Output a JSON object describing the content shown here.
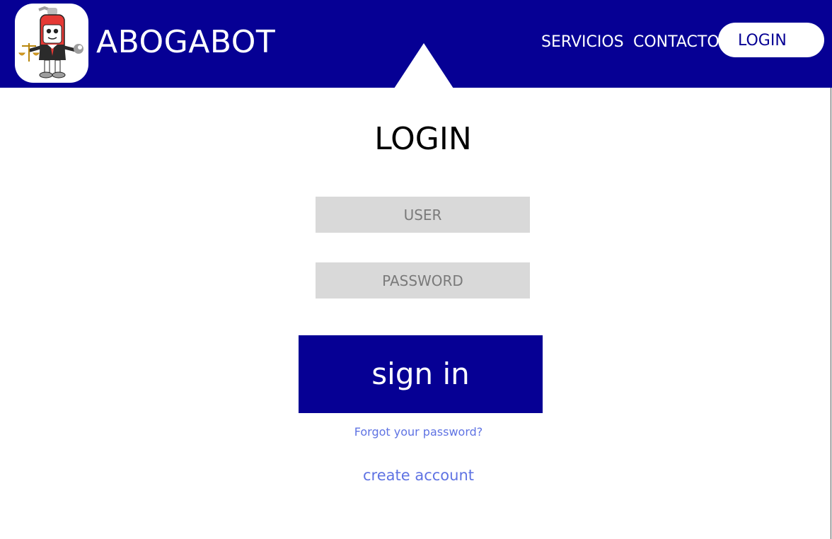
{
  "brand": {
    "name": "ABOGABOT",
    "logo_icon": "robot-lawyer-mascot-icon"
  },
  "nav": {
    "items": [
      {
        "label": "SERVICIOS"
      },
      {
        "label": "CONTACTO"
      }
    ],
    "login_label": "LOGIN"
  },
  "login": {
    "title": "LOGIN",
    "user_placeholder": "USER",
    "password_placeholder": "PASSWORD",
    "submit_label": "sign in",
    "forgot_label": "Forgot your password?",
    "create_label": "create account"
  },
  "colors": {
    "brand_blue": "#060094",
    "field_gray": "#d9d9d9",
    "link_blue": "#5f73e3"
  }
}
